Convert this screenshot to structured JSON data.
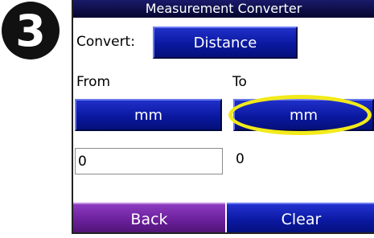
{
  "badge": {
    "number": "3"
  },
  "header": {
    "title": "Measurement Converter"
  },
  "convert": {
    "label": "Convert:",
    "category_button": "Distance"
  },
  "from": {
    "label": "From",
    "unit_button": "mm",
    "value": "0"
  },
  "to": {
    "label": "To",
    "unit_button": "mm",
    "value": "0"
  },
  "footer": {
    "back_label": "Back",
    "clear_label": "Clear"
  },
  "colors": {
    "button_blue": "#0a18a0",
    "back_purple": "#6a1f9a",
    "highlight_yellow": "#f2ea1a",
    "title_bar": "#05052e"
  }
}
